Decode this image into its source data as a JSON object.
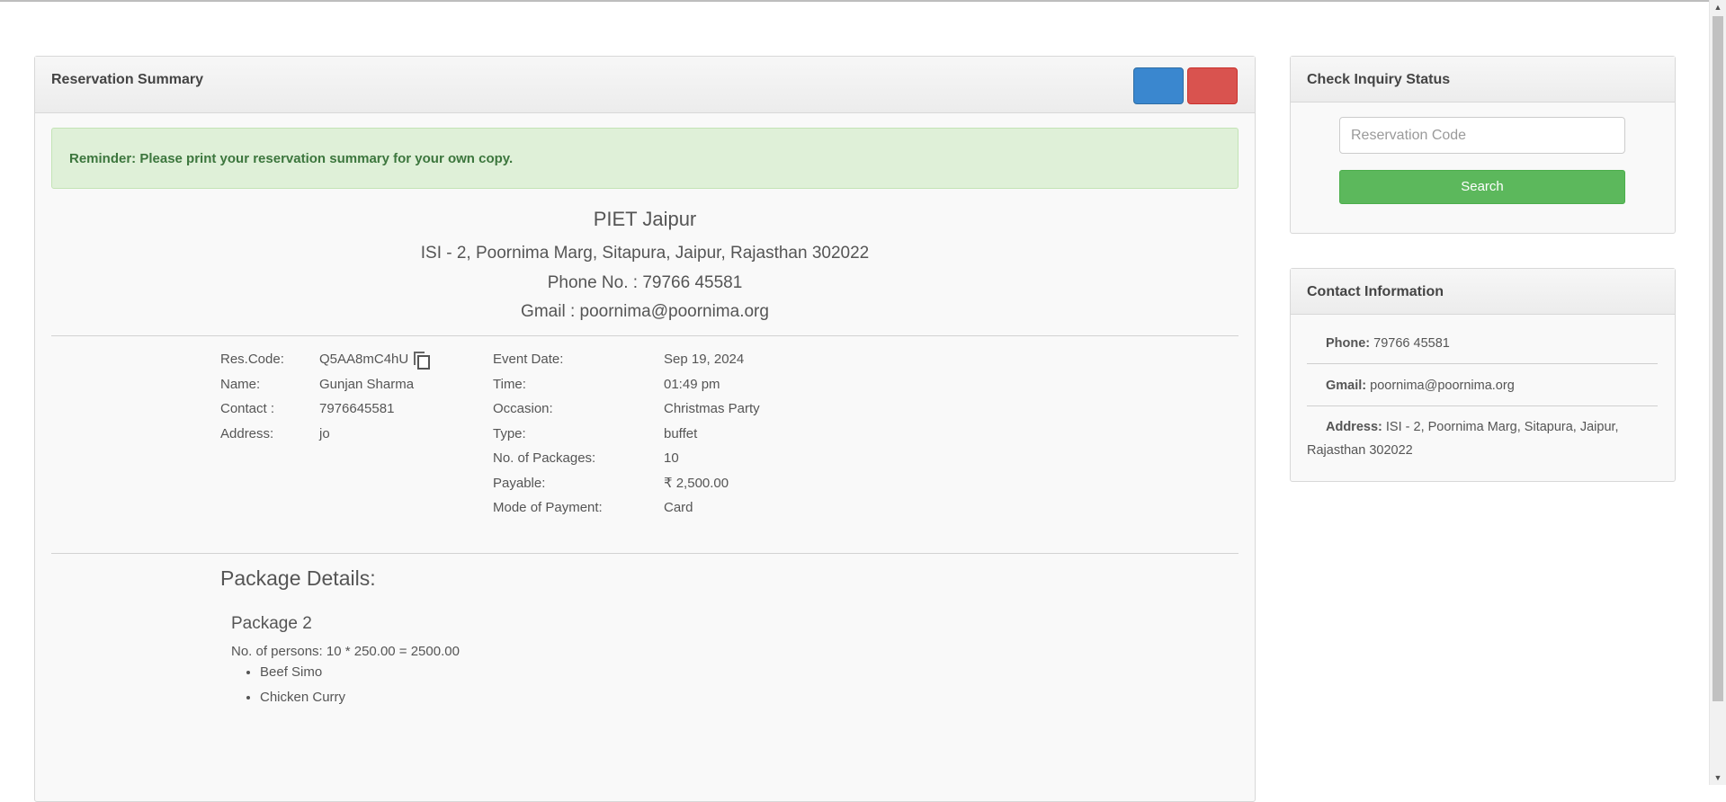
{
  "main": {
    "title": "Reservation Summary",
    "alert": "Reminder: Please print your reservation summary for your own copy.",
    "org": {
      "name": "PIET Jaipur",
      "address": "ISI - 2, Poornima Marg, Sitapura, Jaipur, Rajasthan 302022",
      "phone": "Phone No. : 79766 45581",
      "gmail": "Gmail : poornima@poornima.org"
    },
    "left_details": [
      {
        "label": "Res.Code:",
        "value": "Q5AA8mC4hU"
      },
      {
        "label": "Name:",
        "value": "Gunjan Sharma"
      },
      {
        "label": "Contact :",
        "value": "7976645581"
      },
      {
        "label": "Address:",
        "value": "jo"
      }
    ],
    "right_details": [
      {
        "label": "Event Date:",
        "value": "Sep 19, 2024"
      },
      {
        "label": "Time:",
        "value": "01:49 pm"
      },
      {
        "label": "Occasion:",
        "value": "Christmas Party"
      },
      {
        "label": "Type:",
        "value": "buffet"
      },
      {
        "label": "No. of Packages:",
        "value": "10"
      },
      {
        "label": "Payable:",
        "value": "₹ 2,500.00"
      },
      {
        "label": "Mode of Payment:",
        "value": "Card"
      }
    ],
    "package_heading": "Package Details:",
    "package": {
      "name": "Package 2",
      "persons": "No. of persons: 10 * 250.00 = 2500.00",
      "items": [
        "Beef Simo",
        "Chicken Curry"
      ]
    }
  },
  "inquiry": {
    "title": "Check Inquiry Status",
    "placeholder": "Reservation Code",
    "button": "Search"
  },
  "contact": {
    "title": "Contact Information",
    "phone_key": "Phone:",
    "phone_val": "79766 45581",
    "gmail_key": "Gmail:",
    "gmail_val": "poornima@poornima.org",
    "address_key": "Address:",
    "address_val": "ISI - 2, Poornima Marg, Sitapura, Jaipur, Rajasthan 302022"
  },
  "colors": {
    "print_button": "#3a87cf",
    "cancel_button": "#d9534f",
    "search_button": "#5cb85c",
    "alert_bg": "#dff0d8"
  },
  "icons": {
    "copy": "copy-icon",
    "scroll_up": "chevron-up-icon",
    "scroll_down": "chevron-down-icon"
  }
}
